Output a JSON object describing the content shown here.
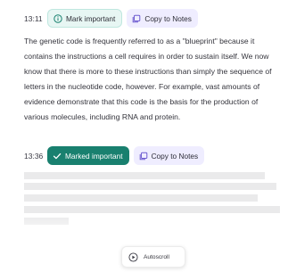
{
  "entries": [
    {
      "time": "13:11",
      "mark_label": "Mark important",
      "mark_icon": "info-circle-icon",
      "copy_label": "Copy to Notes",
      "copy_icon": "copy-square-icon",
      "text": "The genetic code is frequently referred to as a \"blueprint\" because it contains the instructions a cell requires in order to sustain itself. We now know that there is more to these instructions than simply the sequence of letters in the nucleotide code, however. For example, vast amounts of evidence demonstrate that this code is the basis for the production of various molecules, including RNA and protein."
    },
    {
      "time": "13:36",
      "mark_label": "Marked important",
      "mark_icon": "check-icon",
      "copy_label": "Copy to Notes",
      "copy_icon": "copy-square-icon"
    }
  ],
  "autoscroll": {
    "label": "Autoscroll",
    "icon": "play-circle-icon"
  },
  "colors": {
    "mark_chip_bg": "#e7f6f3",
    "marked_chip_bg": "#19806f",
    "copy_chip_bg": "#efedff",
    "accent_purple": "#6d5bd0"
  }
}
